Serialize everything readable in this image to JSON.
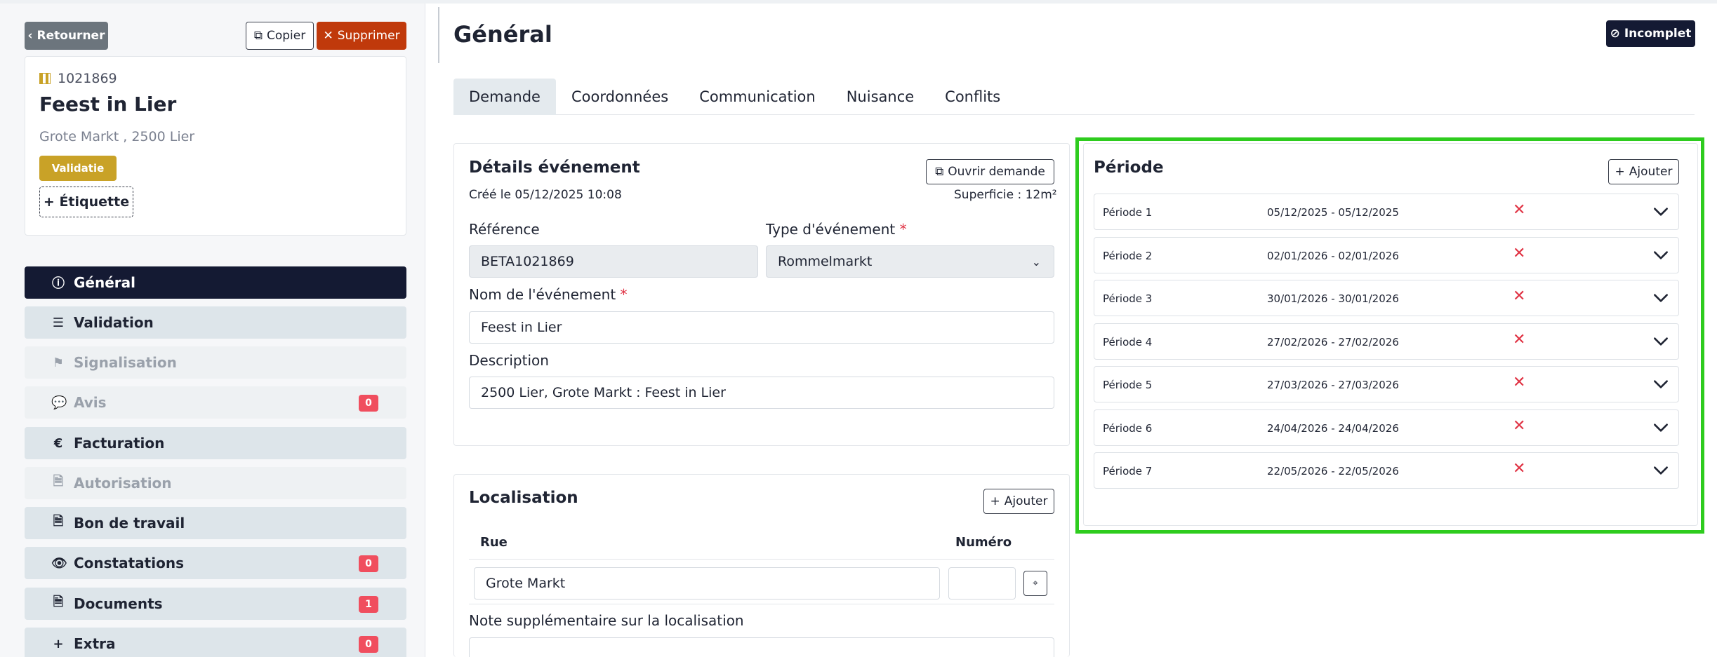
{
  "left": {
    "back_label": "Retourner",
    "copy_label": "Copier",
    "delete_label": "Supprimer",
    "event": {
      "ref": "1021869",
      "name": "Feest in Lier",
      "address": "Grote Markt , 2500 Lier",
      "status_badge": "Validatie",
      "tag_button": "+ Étiquette"
    },
    "nav": [
      {
        "label": "Général",
        "icon": "info-icon",
        "glyph": "ⓘ"
      },
      {
        "label": "Validation",
        "icon": "checklist-icon",
        "glyph": "☰"
      },
      {
        "label": "Signalisation",
        "icon": "signpost-icon",
        "glyph": "⚑"
      },
      {
        "label": "Avis",
        "icon": "comment-icon",
        "glyph": "💬",
        "count": "0"
      },
      {
        "label": "Facturation",
        "icon": "euro-icon",
        "glyph": "€"
      },
      {
        "label": "Autorisation",
        "icon": "file-check-icon",
        "glyph": "🗎"
      },
      {
        "label": "Bon de travail",
        "icon": "file-icon",
        "glyph": "🗎"
      },
      {
        "label": "Constatations",
        "icon": "eye-icon",
        "glyph": "👁",
        "count": "0"
      },
      {
        "label": "Documents",
        "icon": "document-icon",
        "glyph": "🗎",
        "count": "1"
      },
      {
        "label": "Extra",
        "icon": "plus-icon",
        "glyph": "+",
        "count": "0"
      }
    ]
  },
  "header": {
    "title": "Général",
    "status": "Incomplet"
  },
  "tabs": [
    "Demande",
    "Coordonnées",
    "Communication",
    "Nuisance",
    "Conflits"
  ],
  "details": {
    "title": "Détails événement",
    "open_button": "Ouvrir demande",
    "created": "Créé le 05/12/2025 10:08",
    "area": "Superficie : 12m²",
    "reference_label": "Référence",
    "reference_value": "BETA1021869",
    "type_label": "Type d'événement",
    "type_value": "Rommelmarkt",
    "name_label": "Nom de l'événement",
    "name_value": "Feest in Lier",
    "description_label": "Description",
    "description_value": "2500 Lier, Grote Markt : Feest in Lier",
    "required_mark": "*"
  },
  "localisation": {
    "title": "Localisation",
    "add_button": "Ajouter",
    "col_street": "Rue",
    "col_number": "Numéro",
    "street_value": "Grote Markt",
    "number_value": "",
    "note_label": "Note supplémentaire sur la localisation"
  },
  "period": {
    "title": "Période",
    "add_button": "Ajouter",
    "items": [
      {
        "name": "Période 1",
        "dates": "05/12/2025 - 05/12/2025"
      },
      {
        "name": "Période 2",
        "dates": "02/01/2026 - 02/01/2026"
      },
      {
        "name": "Période 3",
        "dates": "30/01/2026 - 30/01/2026"
      },
      {
        "name": "Période 4",
        "dates": "27/02/2026 - 27/02/2026"
      },
      {
        "name": "Période 5",
        "dates": "27/03/2026 - 27/03/2026"
      },
      {
        "name": "Période 6",
        "dates": "24/04/2026 - 24/04/2026"
      },
      {
        "name": "Période 7",
        "dates": "22/05/2026 - 22/05/2026"
      }
    ]
  },
  "colors": {
    "dark": "#141a33",
    "danger": "#c0390b",
    "badge": "#c9a227",
    "highlight": "#2ecc1e",
    "count_badge": "#f04e5e"
  }
}
